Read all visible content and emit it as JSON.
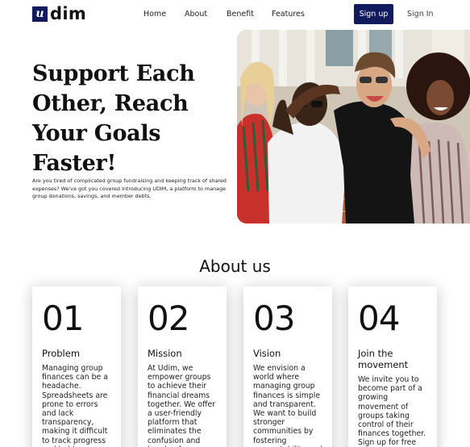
{
  "brand": {
    "logo_mark": "u",
    "name": "dim"
  },
  "nav": {
    "items": [
      "Home",
      "About",
      "Benefit",
      "Features"
    ],
    "signup_label": "Sign up",
    "signin_label": "Sign In"
  },
  "hero": {
    "title": "Support Each Other, Reach Your Goals Faster!",
    "subtitle": "Are you tired of complicated group fundraising and keeping track of shared expenses? We've got you covered Introducing UDIM, a platform to manage group donations, savings, and member debts."
  },
  "about": {
    "title": "About us",
    "cards": [
      {
        "number": "01",
        "heading": "Problem",
        "body": "Managing group finances can be a headache. Spreadsheets are prone to errors and lack transparency, making it difficult to track progress and hold"
      },
      {
        "number": "02",
        "heading": "Mission",
        "body": "At Udim, we empower groups to achieve their financial dreams together. We offer a user-friendly platform that eliminates the confusion and hassle of"
      },
      {
        "number": "03",
        "heading": "Vision",
        "body": "We envision a world where managing group finances is simple and transparent. We want to build stronger communities by fostering accountability and"
      },
      {
        "number": "04",
        "heading": "Join the movement",
        "body": "We invite you to become part of a growing movement of groups taking control of their finances together. Sign up for free"
      }
    ]
  },
  "colors": {
    "brand_navy": "#101a5c",
    "text": "#111111",
    "background": "#ffffff"
  }
}
